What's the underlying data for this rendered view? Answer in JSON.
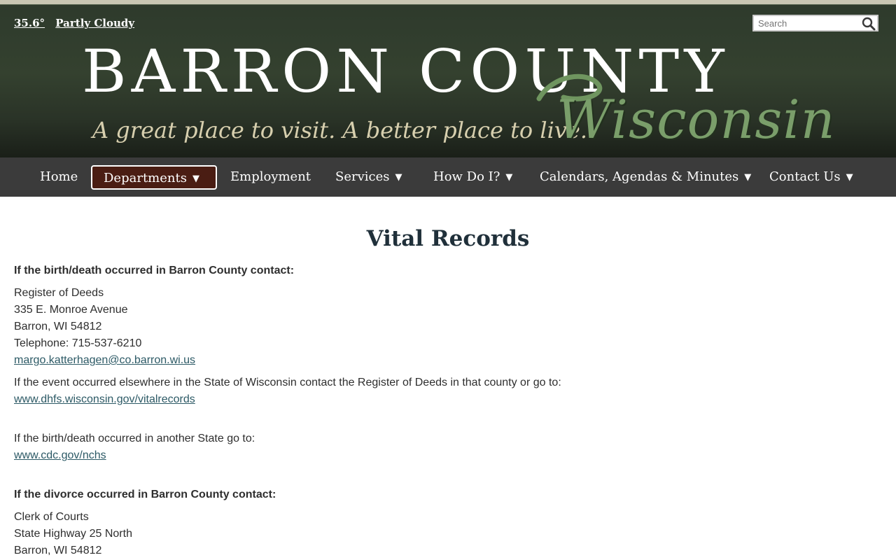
{
  "weather": {
    "temperature": "35.6°",
    "condition": "Partly Cloudy"
  },
  "search": {
    "placeholder": "Search"
  },
  "logo": {
    "title": "BARRON COUNTY",
    "tagline": "A great place to visit. A better place to live.",
    "state": "Wisconsin"
  },
  "nav": {
    "items": [
      {
        "label": "Home"
      },
      {
        "label": "Departments",
        "caret": "▼"
      },
      {
        "label": "Employment"
      },
      {
        "label": "Services",
        "caret": "▼"
      },
      {
        "label": "How Do I?",
        "caret": "▼"
      },
      {
        "label": "Calendars, Agendas & Minutes",
        "caret": "▼"
      },
      {
        "label": "Contact Us",
        "caret": "▼"
      }
    ]
  },
  "page": {
    "title": "Vital Records",
    "birth_death_heading": "If the birth/death occurred in Barron County contact:",
    "rod": {
      "name": "Register of Deeds",
      "street": "335 E. Monroe Avenue",
      "city": "Barron, WI 54812",
      "phone": "Telephone: 715-537-6210",
      "email": "margo.katterhagen@co.barron.wi.us"
    },
    "elsewhere_text": "If the event occurred elsewhere in the State of Wisconsin contact the Register of Deeds in that county or go to:",
    "elsewhere_link": "www.dhfs.wisconsin.gov/vitalrecords",
    "other_state_text": "If the birth/death occurred in another State go to:",
    "other_state_link": "www.cdc.gov/nchs",
    "divorce_heading": "If the divorce occurred in Barron County contact:",
    "clerk": {
      "name": "Clerk of Courts",
      "street": "State Highway 25 North",
      "city": "Barron, WI 54812"
    }
  }
}
